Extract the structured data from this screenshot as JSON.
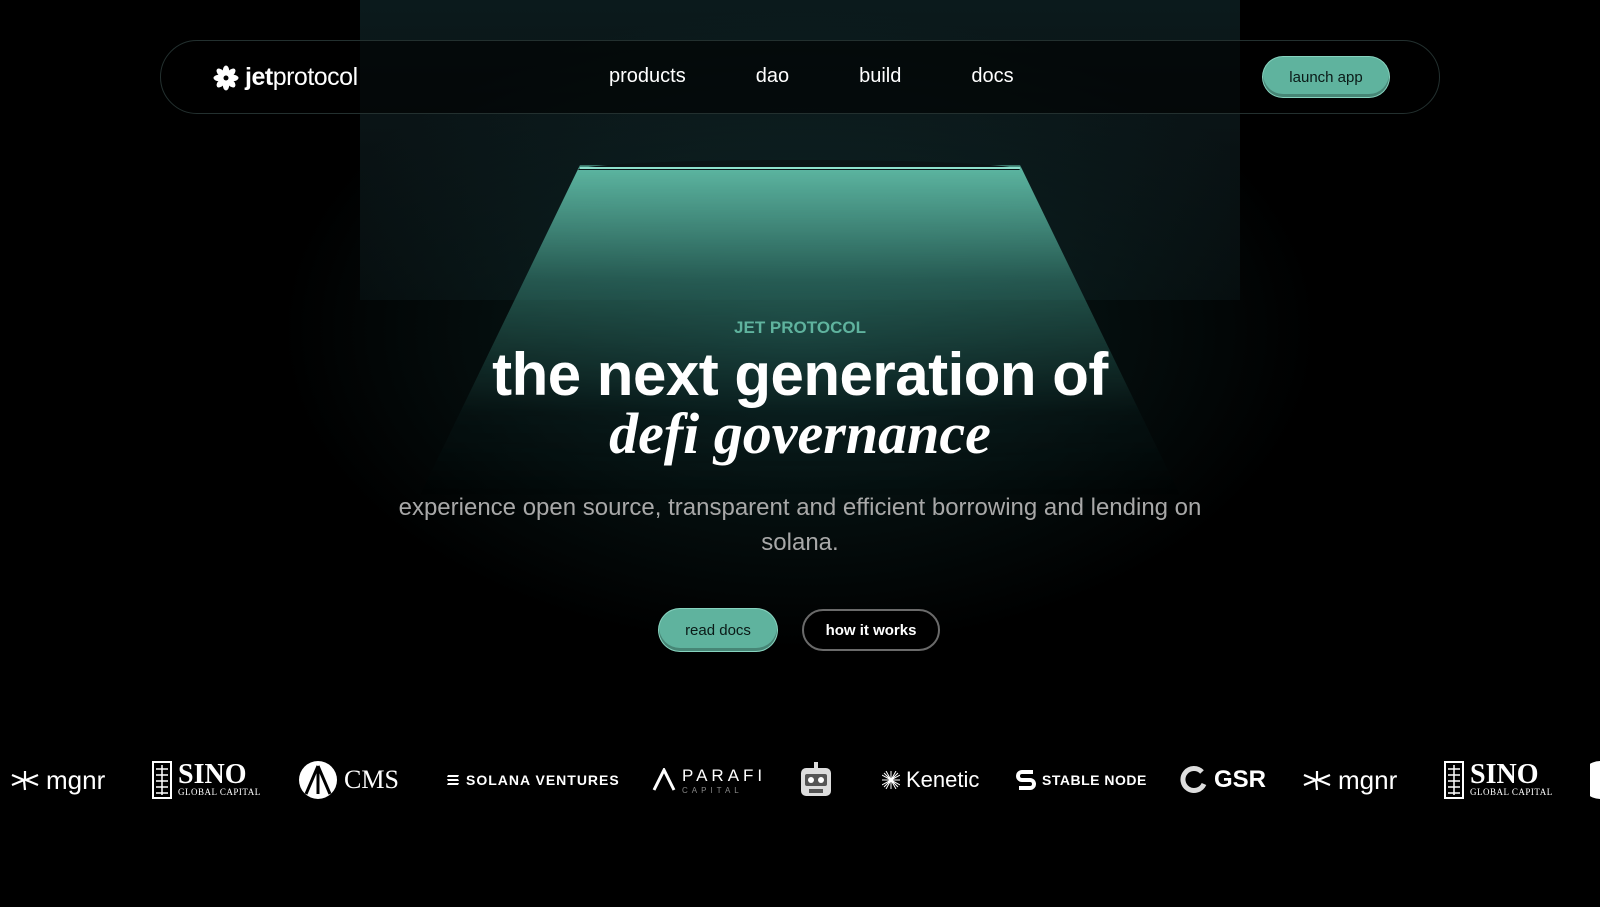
{
  "nav": {
    "logo_bold": "jet",
    "logo_light": "protocol",
    "links": [
      "products",
      "dao",
      "build",
      "docs"
    ],
    "launch_label": "launch app"
  },
  "hero": {
    "eyebrow": "JET PROTOCOL",
    "title_line1": "the next generation of",
    "title_line2": "defi governance",
    "subtitle": "experience open source, transparent and efficient borrowing and lending on solana.",
    "primary_cta": "read docs",
    "secondary_cta": "how it works"
  },
  "partners": {
    "mgnr": "mgnr",
    "sino_main": "SINO",
    "sino_sub": "GLOBAL CAPITAL",
    "cms": "CMS",
    "solana_ventures": "SOLANA VENTURES",
    "parafi_main": "PARAFI",
    "parafi_sub": "CAPITAL",
    "kenetic": "Kenetic",
    "stable_node": "STABLE NODE",
    "gsr": "GSR"
  },
  "colors": {
    "accent": "#5fb39e",
    "background": "#000000",
    "subtitle": "#a8a8a8"
  }
}
